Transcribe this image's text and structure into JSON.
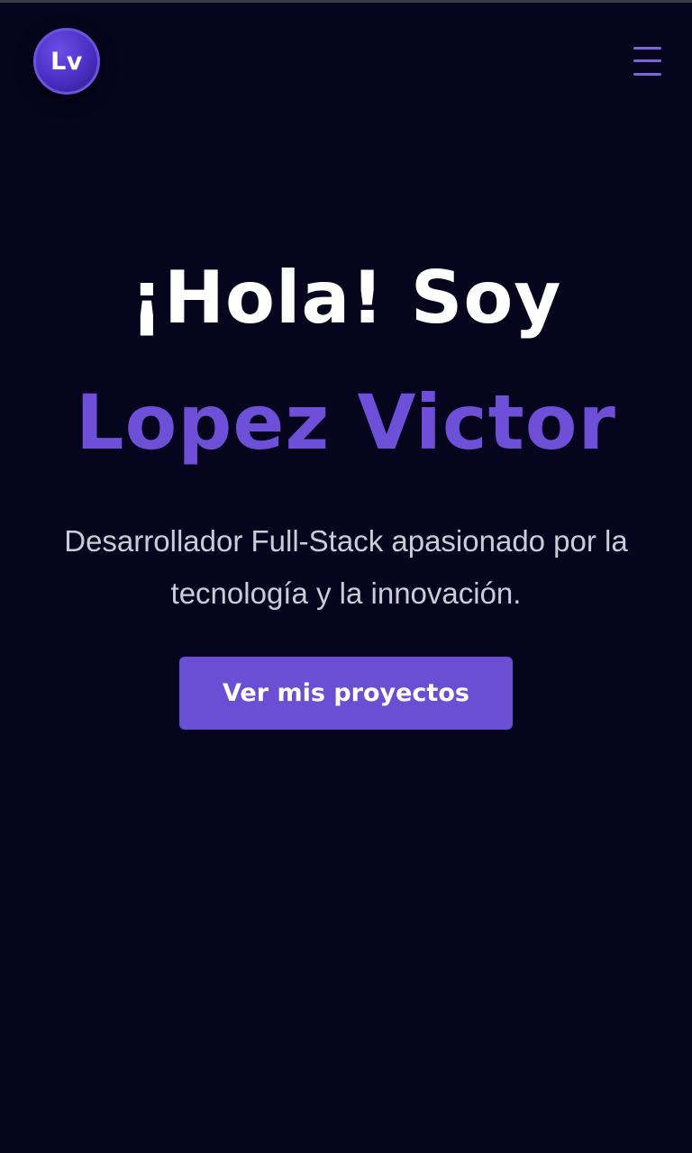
{
  "header": {
    "logo_text": "Lv",
    "menu_icon": "hamburger-menu-icon"
  },
  "hero": {
    "greeting": "¡Hola! Soy",
    "name": "Lopez Victor",
    "description": "Desarrollador Full-Stack apasionado por la tecnología y la innovación.",
    "cta_label": "Ver mis proyectos"
  },
  "colors": {
    "background": "#07041e",
    "accent": "#6a4fd4",
    "name_text": "#6d4fd8",
    "body_text": "#cdcbd8",
    "menu_icon": "#7e66d6"
  }
}
